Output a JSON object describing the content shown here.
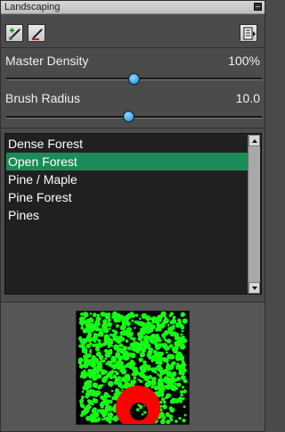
{
  "window": {
    "title": "Landscaping"
  },
  "toolbar": {
    "tools": [
      {
        "name": "paint-tool",
        "icon": "paint-brush-add-icon",
        "selected": false
      },
      {
        "name": "erase-tool",
        "icon": "erase-brush-icon",
        "selected": false
      }
    ],
    "menu_icon": "panel-menu-icon"
  },
  "controls": {
    "master_density": {
      "label": "Master Density",
      "value": "100%",
      "slider_fraction": 0.5
    },
    "brush_radius": {
      "label": "Brush Radius",
      "value": "10.0",
      "slider_fraction": 0.48
    }
  },
  "list": {
    "items": [
      "Dense Forest",
      "Open Forest",
      "Pine / Maple",
      "Pine Forest",
      "Pines"
    ],
    "selected_index": 1
  },
  "preview": {
    "colors": {
      "vegetation": "#14ff14",
      "brush": "#ff0000",
      "background": "#000000"
    }
  }
}
